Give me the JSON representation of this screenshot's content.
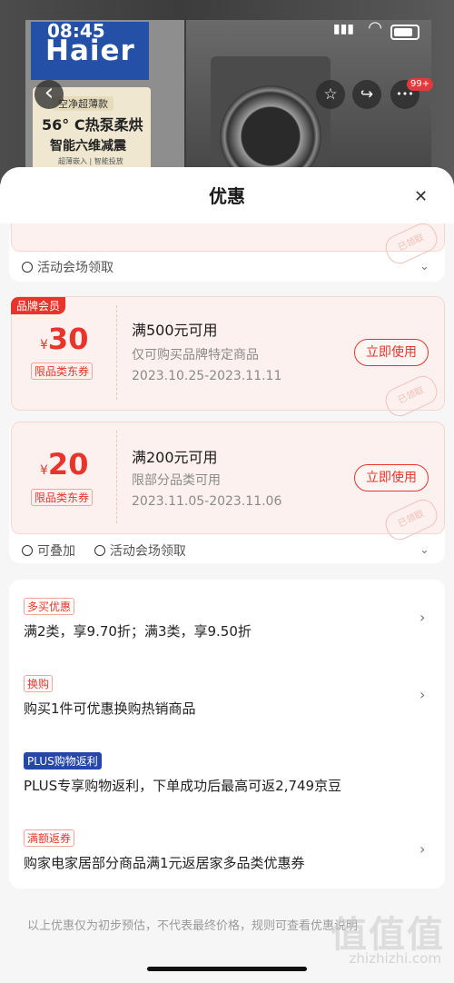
{
  "status_bar": {
    "time": "08:45",
    "signal": "▮▮▮",
    "wifi": "◠"
  },
  "product": {
    "brand": "Haier",
    "promo_tag": "空净超薄款",
    "promo_line1": "56° C热泵柔烘",
    "promo_line2": "智能六维减震",
    "promo_line3": "超薄嵌入 | 智能投放"
  },
  "nav": {
    "back": "‹",
    "star": "☆",
    "share": "↪",
    "more": "•••",
    "badge": "99+"
  },
  "sheet": {
    "title": "优惠",
    "close": "✕"
  },
  "coupon_top": {
    "footer_label": "活动会场领取",
    "stamp": "已领取"
  },
  "coupons": [
    {
      "member_tag": "品牌会员",
      "currency": "¥",
      "amount": "30",
      "category_tag": "限品类东券",
      "condition": "满500元可用",
      "desc": "仅可购买品牌特定商品",
      "date": "2023.10.25-2023.11.11",
      "button": "立即使用",
      "stamp": "已领取"
    },
    {
      "currency": "¥",
      "amount": "20",
      "category_tag": "限品类东券",
      "condition": "满200元可用",
      "desc": "限部分品类可用",
      "date": "2023.11.05-2023.11.06",
      "button": "立即使用",
      "stamp": "已领取",
      "footer_stackable": "可叠加",
      "footer_label": "活动会场领取"
    }
  ],
  "offers": [
    {
      "tag": "多买优惠",
      "text": "满2类，享9.70折；满3类，享9.50折"
    },
    {
      "tag": "换购",
      "text": "购买1件可优惠换购热销商品"
    },
    {
      "tag": "PLUS购物返利",
      "text": "PLUS专享购物返利，下单成功后最高可返2,749京豆"
    },
    {
      "tag": "满额返券",
      "text": "购家电家居部分商品满1元返居家多品类优惠券"
    }
  ],
  "disclaimer": "以上优惠仅为初步预估，不代表最终价格，规则可查看优惠说明",
  "watermark": {
    "logo": "值值值",
    "url": "zhizhizhi.com"
  }
}
